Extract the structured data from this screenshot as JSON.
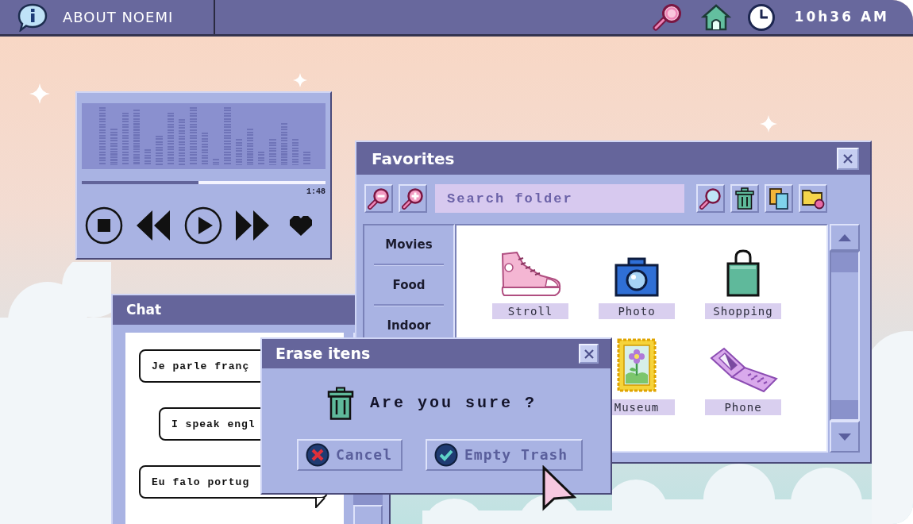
{
  "top_bar": {
    "title": "ABOUT NOEMI",
    "time": "10h36 AM"
  },
  "music_player": {
    "progress": {
      "level": 0.48
    },
    "time": "1:48"
  },
  "favorites": {
    "title": "Favorites",
    "search": {
      "placeholder": "Search folder"
    },
    "sidebar": [
      {
        "label": "Movies"
      },
      {
        "label": "Food"
      },
      {
        "label": "Indoor"
      }
    ],
    "items": [
      {
        "label": "Stroll",
        "kind": "sneaker"
      },
      {
        "label": "Photo",
        "kind": "camera"
      },
      {
        "label": "Shopping",
        "kind": "bag"
      },
      {
        "label": "Museum",
        "kind": "frame"
      },
      {
        "label": "Phone",
        "kind": "phone"
      }
    ]
  },
  "chat": {
    "title": "Chat",
    "messages": [
      {
        "text": "Je parle franç",
        "kind": "received"
      },
      {
        "text": "I speak engl",
        "kind": "sent"
      },
      {
        "text": "Eu falo portug",
        "kind": "received",
        "tail": true
      }
    ]
  },
  "dialog": {
    "title": "Erase itens",
    "message": "Are you sure ?",
    "buttons": [
      {
        "label": "Cancel",
        "kind": "cancel"
      },
      {
        "label": "Empty Trash",
        "kind": "confirm"
      }
    ]
  }
}
